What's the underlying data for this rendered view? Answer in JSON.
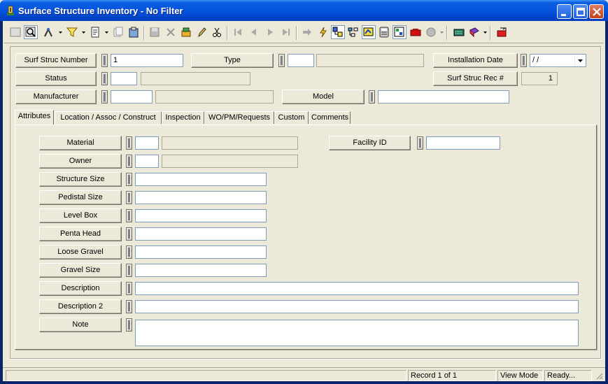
{
  "window": {
    "title": "Surface Structure Inventory - No Filter"
  },
  "toolbar": {
    "icons": [
      "grid-icon",
      "search-record-icon",
      "query-icon",
      "filter-icon",
      "new-record-icon",
      "copy-icon",
      "paste-icon",
      "save-icon",
      "delete-icon",
      "attach-icon",
      "edit-icon",
      "cut-icon",
      "first-record-icon",
      "prev-record-icon",
      "next-record-icon",
      "last-record-icon",
      "goto-icon",
      "lightning-icon",
      "map-link-icon",
      "hierarchy-icon",
      "map-icon",
      "calculator-icon",
      "report-icon",
      "bookmark-icon",
      "globe-icon",
      "keyboard-icon",
      "help-book-icon",
      "exit-icon"
    ]
  },
  "header": {
    "surf_struc_number_label": "Surf Struc Number",
    "surf_struc_number_value": "1",
    "type_label": "Type",
    "type_value": "",
    "installation_date_label": "Installation Date",
    "installation_date_value": " / /",
    "status_label": "Status",
    "status_value": "",
    "surf_struc_rec_label": "Surf Struc Rec #",
    "surf_struc_rec_value": "1",
    "manufacturer_label": "Manufacturer",
    "manufacturer_value": "",
    "model_label": "Model",
    "model_value": ""
  },
  "tabs": [
    {
      "label": "Attributes"
    },
    {
      "label": "Location / Assoc / Construct"
    },
    {
      "label": "Inspection"
    },
    {
      "label": "WO/PM/Requests"
    },
    {
      "label": "Custom"
    },
    {
      "label": "Comments"
    }
  ],
  "attributes": {
    "material_label": "Material",
    "material_value": "",
    "owner_label": "Owner",
    "owner_value": "",
    "facility_id_label": "Facility ID",
    "facility_id_value": "",
    "structure_size_label": "Structure Size",
    "structure_size_value": "",
    "pedistal_size_label": "Pedistal Size",
    "pedistal_size_value": "",
    "level_box_label": "Level Box",
    "level_box_value": "",
    "penta_head_label": "Penta Head",
    "penta_head_value": "",
    "loose_gravel_label": "Loose Gravel",
    "loose_gravel_value": "",
    "gravel_size_label": "Gravel Size",
    "gravel_size_value": "",
    "description_label": "Description",
    "description_value": "",
    "description2_label": "Description 2",
    "description2_value": "",
    "note_label": "Note",
    "note_value": ""
  },
  "status": {
    "record": "Record 1 of 1",
    "mode": "View Mode",
    "state": "Ready..."
  },
  "colors": {
    "title_blue": "#0553DD",
    "face": "#ECE9D8",
    "close_red": "#C0401E"
  }
}
